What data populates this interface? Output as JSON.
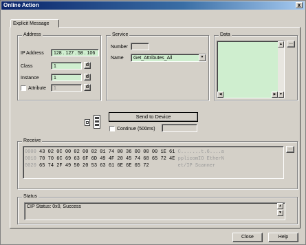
{
  "window": {
    "title": "Online Action",
    "close_glyph": "x"
  },
  "tab": {
    "label": "Explicit Message"
  },
  "address": {
    "group_label": "Address",
    "ip_label": "IP Address",
    "ip_value": "128 . 127 . 58 . 106",
    "class_label": "Class",
    "class_value": "1",
    "instance_label": "Instance",
    "instance_value": "1",
    "attribute_label": "Attribute",
    "attribute_value": "1",
    "decimal_btn": "d"
  },
  "service": {
    "group_label": "Service",
    "number_label": "Number",
    "number_value": "",
    "name_label": "Name",
    "name_value": "Get_Attributes_All"
  },
  "data": {
    "group_label": "Data",
    "ellipsis": "..."
  },
  "send": {
    "button_label": "Send to Device",
    "continuous_label": "Continue (500ms)",
    "interval_value": ""
  },
  "receive": {
    "group_label": "Receive",
    "ellipsis": "...",
    "rows": [
      {
        "offset": "0000",
        "bytes": "43 02 0C 00 02 00 02 01 74 00 36 00 00 00 1E 61",
        "ascii": "C.......t.6....a"
      },
      {
        "offset": "0010",
        "bytes": "70 70 6C 69 63 6F 6D 49 4F 20 45 74 68 65 72 4E",
        "ascii": "pplicomIO EtherN"
      },
      {
        "offset": "0020",
        "bytes": "65 74 2F 49 50 20 53 63 61 6E 6E 65 72",
        "ascii": "et/IP Scanner"
      }
    ]
  },
  "status": {
    "group_label": "Status",
    "text": "CIP Status: 0x0, Success"
  },
  "footer": {
    "close_label": "Close",
    "help_label": "Help"
  }
}
